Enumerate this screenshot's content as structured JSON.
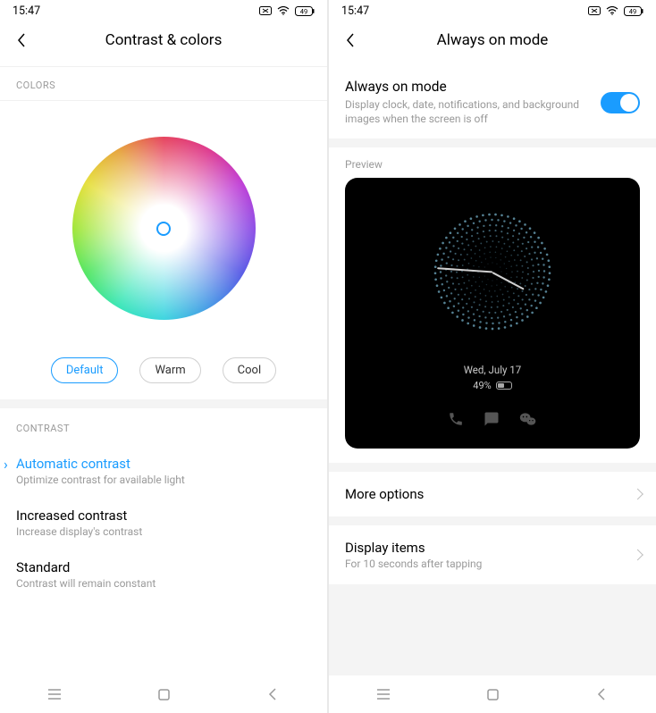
{
  "left": {
    "status": {
      "time": "15:47",
      "battery": "49"
    },
    "title": "Contrast & colors",
    "colors_label": "COLORS",
    "presets": {
      "default": "Default",
      "warm": "Warm",
      "cool": "Cool"
    },
    "contrast_label": "CONTRAST",
    "items": {
      "auto": {
        "title": "Automatic contrast",
        "sub": "Optimize contrast for available light"
      },
      "inc": {
        "title": "Increased contrast",
        "sub": "Increase display's contrast"
      },
      "std": {
        "title": "Standard",
        "sub": "Contrast will remain constant"
      }
    }
  },
  "right": {
    "status": {
      "time": "15:47",
      "battery": "49"
    },
    "title": "Always on mode",
    "toggle": {
      "title": "Always on mode",
      "desc": "Display clock, date, notifications, and background images when the screen is off"
    },
    "preview_label": "Preview",
    "aod": {
      "date": "Wed, July 17",
      "battery": "49%"
    },
    "more_options": "More options",
    "display_items": {
      "title": "Display items",
      "sub": "For 10 seconds after tapping"
    }
  }
}
